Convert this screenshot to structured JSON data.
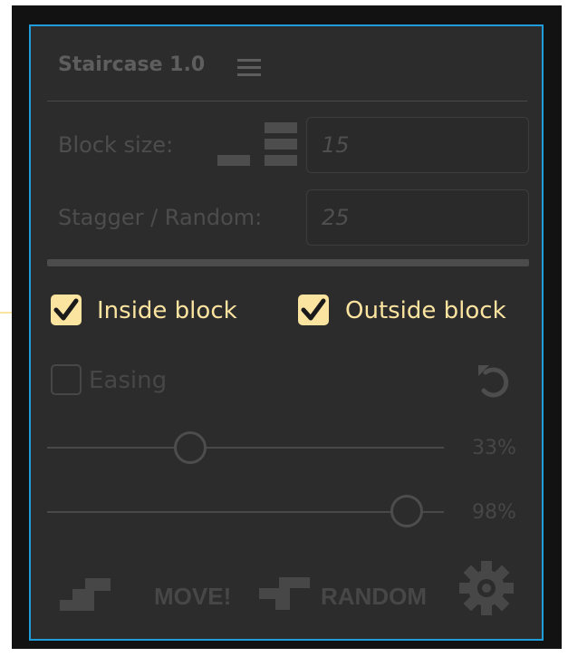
{
  "panel": {
    "title": "Staircase 1.0",
    "menu_icon": "hamburger-menu-icon"
  },
  "block_size": {
    "label": "Block size:",
    "value": "15",
    "icon": "block-size-icon"
  },
  "stagger": {
    "label": "Stagger / Random:",
    "value": "25"
  },
  "checkboxes": {
    "inside_block": {
      "label": "Inside block",
      "checked": true
    },
    "outside_block": {
      "label": "Outside block",
      "checked": true
    },
    "easing": {
      "label": "Easing",
      "checked": false
    }
  },
  "reset_icon": "undo-arrow-icon",
  "sliders": [
    {
      "value_label": "33%",
      "value": 0.33
    },
    {
      "value_label": "98%",
      "value": 0.98
    }
  ],
  "buttons": {
    "move": {
      "label": "MOVE!",
      "icon": "stairs-icon"
    },
    "random": {
      "label": "RANDOM",
      "icon": "random-stairs-icon"
    },
    "settings": {
      "icon": "gear-icon"
    }
  },
  "colors": {
    "accent": "#fbe3a0",
    "panel_border": "#1f9ddb",
    "panel_bg": "#2c2c2c",
    "muted_text": "#4d4d4d"
  }
}
